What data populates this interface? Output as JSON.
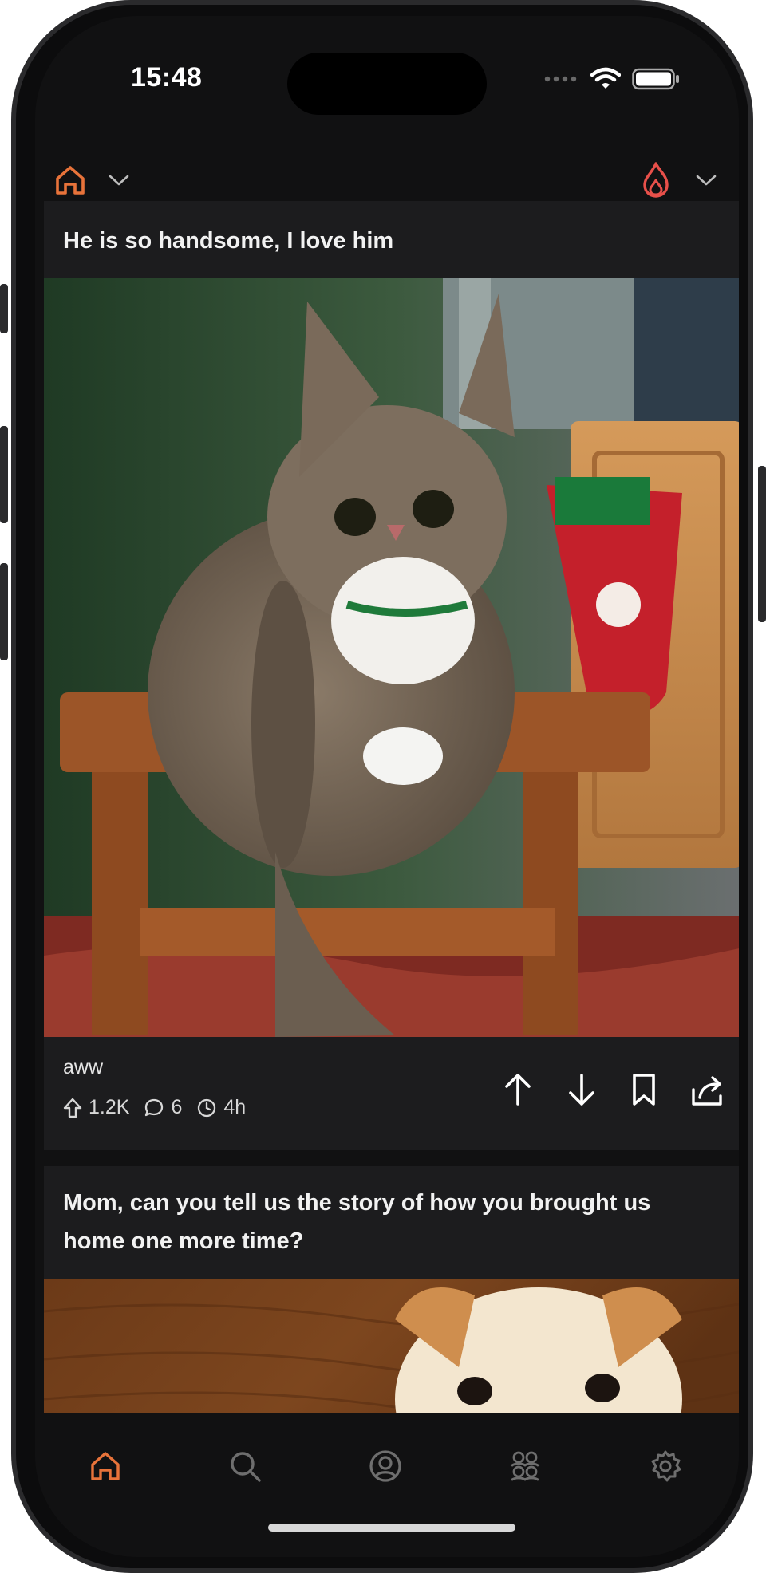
{
  "status_bar": {
    "time": "15:48"
  },
  "header": {
    "left_icon": "home-icon",
    "right_icon": "flame-icon",
    "accent_color": "#e8733a",
    "flame_color": "#e8504a"
  },
  "posts": [
    {
      "title": "He is so handsome, I love him",
      "image": "cat-photo",
      "community": "aww",
      "upvotes": "1.2K",
      "comments": "6",
      "age": "4h"
    },
    {
      "title": "Mom, can you tell us the story of how you brought us home one more time?",
      "image": "dog-photo"
    }
  ],
  "tabbar": {
    "items": [
      "home",
      "search",
      "profile",
      "communities",
      "settings"
    ],
    "active": "home"
  }
}
